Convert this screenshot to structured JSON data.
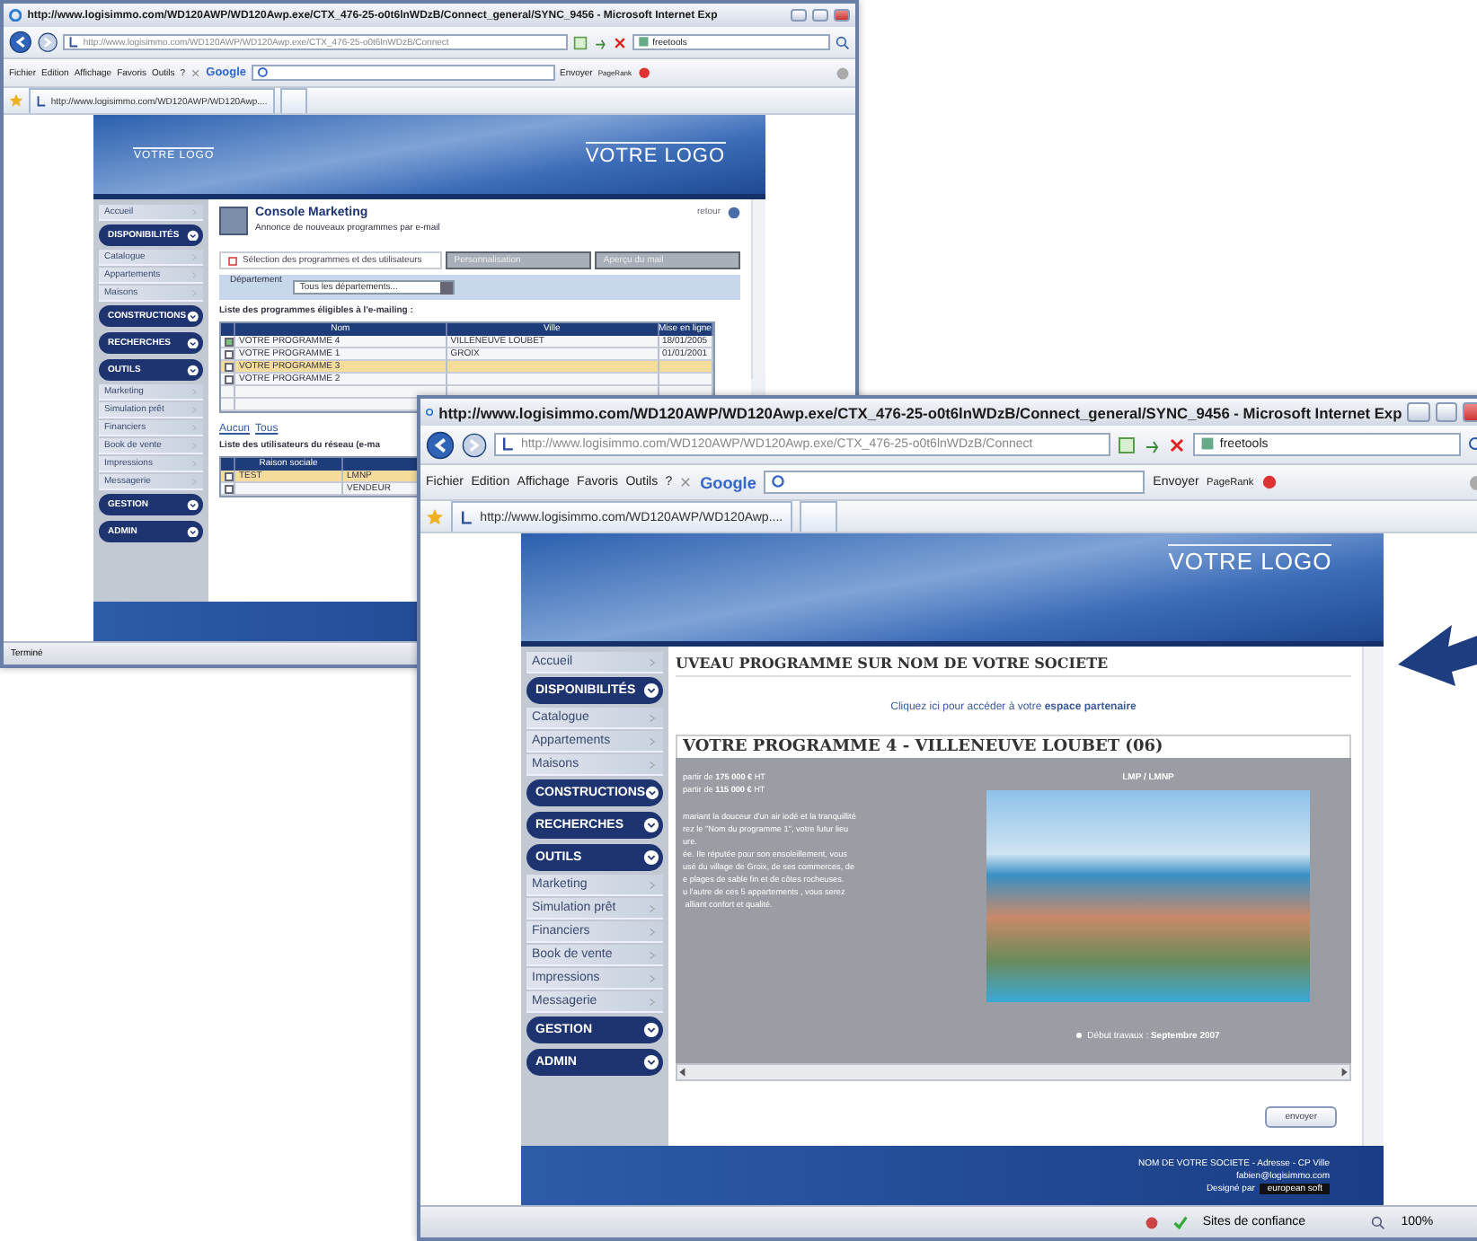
{
  "windows": [
    {
      "kind": "back",
      "title": "http://www.logisimmo.com/WD120AWP/WD120Awp.exe/CTX_476-25-o0t6lnWDzB/Connect_general/SYNC_9456 - Microsoft Internet Exp",
      "address": "http://www.logisimmo.com/WD120AWP/WD120Awp.exe/CTX_476-25-o0t6lnWDzB/Connect",
      "search": "freetools",
      "menu": [
        "Fichier",
        "Edition",
        "Affichage",
        "Favoris",
        "Outils",
        "?"
      ],
      "google": "Google",
      "send": "Envoyer",
      "pagerank": "PageRank",
      "tab": "http://www.logisimmo.com/WD120AWP/WD120Awp....",
      "status": "Terminé",
      "site": {
        "logo_small": "VOTRE LOGO",
        "logo": "VOTRE LOGO",
        "sidebar": [
          {
            "kind": "link",
            "label": "Accueil"
          },
          {
            "kind": "section",
            "label": "DISPONIBILITÉS"
          },
          {
            "kind": "link",
            "label": "Catalogue"
          },
          {
            "kind": "link",
            "label": "Appartements"
          },
          {
            "kind": "link",
            "label": "Maisons"
          },
          {
            "kind": "section",
            "label": "CONSTRUCTIONS"
          },
          {
            "kind": "section",
            "label": "RECHERCHES"
          },
          {
            "kind": "section",
            "label": "OUTILS"
          },
          {
            "kind": "link",
            "label": "Marketing"
          },
          {
            "kind": "link",
            "label": "Simulation prêt"
          },
          {
            "kind": "link",
            "label": "Financiers"
          },
          {
            "kind": "link",
            "label": "Book de vente"
          },
          {
            "kind": "link",
            "label": "Impressions"
          },
          {
            "kind": "link",
            "label": "Messagerie"
          },
          {
            "kind": "section",
            "label": "GESTION"
          },
          {
            "kind": "section",
            "label": "ADMIN"
          }
        ],
        "console": {
          "title": "Console Marketing",
          "subtitle": "Annonce de nouveaux programmes par e-mail",
          "back_link": "retour",
          "tabs": [
            {
              "label": "Sélection des programmes et des utilisateurs",
              "selected": true
            },
            {
              "label": "Personnalisation",
              "selected": false
            },
            {
              "label": "Aperçu du mail",
              "selected": false
            }
          ],
          "filter": {
            "label": "Département",
            "value": "Tous les départements..."
          },
          "list_title": "Liste des programmes éligibles à l'e-mailing :",
          "columns": [
            "Nom",
            "Ville",
            "Mise en ligne"
          ],
          "rows": [
            {
              "cells": [
                "VOTRE PROGRAMME 4",
                "VILLENEUVE LOUBET",
                "18/01/2005"
              ],
              "checked": true,
              "selected": false
            },
            {
              "cells": [
                "VOTRE PROGRAMME 1",
                "GROIX",
                "01/01/2001"
              ],
              "checked": false,
              "selected": false
            },
            {
              "cells": [
                "VOTRE PROGRAMME 3",
                "",
                ""
              ],
              "checked": false,
              "selected": true
            },
            {
              "cells": [
                "VOTRE PROGRAMME 2",
                "",
                ""
              ],
              "checked": false,
              "selected": false
            }
          ],
          "select_links": [
            "Aucun",
            "Tous"
          ],
          "users_title": "Liste des utilisateurs du réseau (e-ma",
          "user_columns": [
            "Raison sociale"
          ],
          "user_rows": [
            {
              "cells": [
                "TEST",
                "LMNP"
              ],
              "checked": false,
              "selected": true
            },
            {
              "cells": [
                "",
                "VENDEUR"
              ],
              "checked": false,
              "selected": false
            }
          ]
        }
      }
    },
    {
      "kind": "front",
      "title": "http://www.logisimmo.com/WD120AWP/WD120Awp.exe/CTX_476-25-o0t6lnWDzB/Connect_general/SYNC_9456 - Microsoft Internet Exp",
      "address": "http://www.logisimmo.com/WD120AWP/WD120Awp.exe/CTX_476-25-o0t6lnWDzB/Connect",
      "search": "freetools",
      "menu": [
        "Fichier",
        "Edition",
        "Affichage",
        "Favoris",
        "Outils",
        "?"
      ],
      "google": "Google",
      "send": "Envoyer",
      "pagerank": "PageRank",
      "tab": "http://www.logisimmo.com/WD120AWP/WD120Awp....",
      "status": "Sites de confiance",
      "zoom": "100%",
      "site": {
        "logo": "VOTRE LOGO",
        "sidebar": [
          {
            "kind": "link",
            "label": "Accueil"
          },
          {
            "kind": "section",
            "label": "DISPONIBILITÉS"
          },
          {
            "kind": "link",
            "label": "Catalogue"
          },
          {
            "kind": "link",
            "label": "Appartements"
          },
          {
            "kind": "link",
            "label": "Maisons"
          },
          {
            "kind": "section",
            "label": "CONSTRUCTIONS"
          },
          {
            "kind": "section",
            "label": "RECHERCHES"
          },
          {
            "kind": "section",
            "label": "OUTILS"
          },
          {
            "kind": "link",
            "label": "Marketing"
          },
          {
            "kind": "link",
            "label": "Simulation prêt"
          },
          {
            "kind": "link",
            "label": "Financiers"
          },
          {
            "kind": "link",
            "label": "Book de vente"
          },
          {
            "kind": "link",
            "label": "Impressions"
          },
          {
            "kind": "link",
            "label": "Messagerie"
          },
          {
            "kind": "section",
            "label": "GESTION"
          },
          {
            "kind": "section",
            "label": "ADMIN"
          }
        ],
        "mail": {
          "heading": "UVEAU PROGRAMME SUR NOM DE VOTRE SOCIETE",
          "partner_text": "Cliquez ici pour accéder à votre **espace partenaire**",
          "program_title": "VOTRE PROGRAMME 4 - VILLENEUVE LOUBET (06)",
          "prices": [
            "partir de **175 000 €** HT",
            "partir de **115 000 €** HT"
          ],
          "description": [
            "mariant la douceur d'un air iodé et la tranquillité",
            "rez le \"Nom du programme 1\", votre futur lieu",
            "ure.",
            "ée. Ile réputée pour son ensoleillement, vous",
            "usé du village de Groix, de ses commerces, de",
            "e plages de sable fin et de côtes rocheuses.",
            "u l'autre de ces 5 appartements , vous serez",
            " alliant confort et qualité."
          ],
          "type_label": "LMP / LMNP",
          "bullets": [
            {
              "label": "Début travaux :",
              "value": "Septembre 2007"
            }
          ],
          "button": "envoyer",
          "footer": [
            "NOM DE VOTRE SOCIETE - Adresse - CP Ville",
            "fabien@logisimmo.com"
          ],
          "designer_label": "Designé par",
          "designer": "european soft"
        }
      }
    }
  ]
}
